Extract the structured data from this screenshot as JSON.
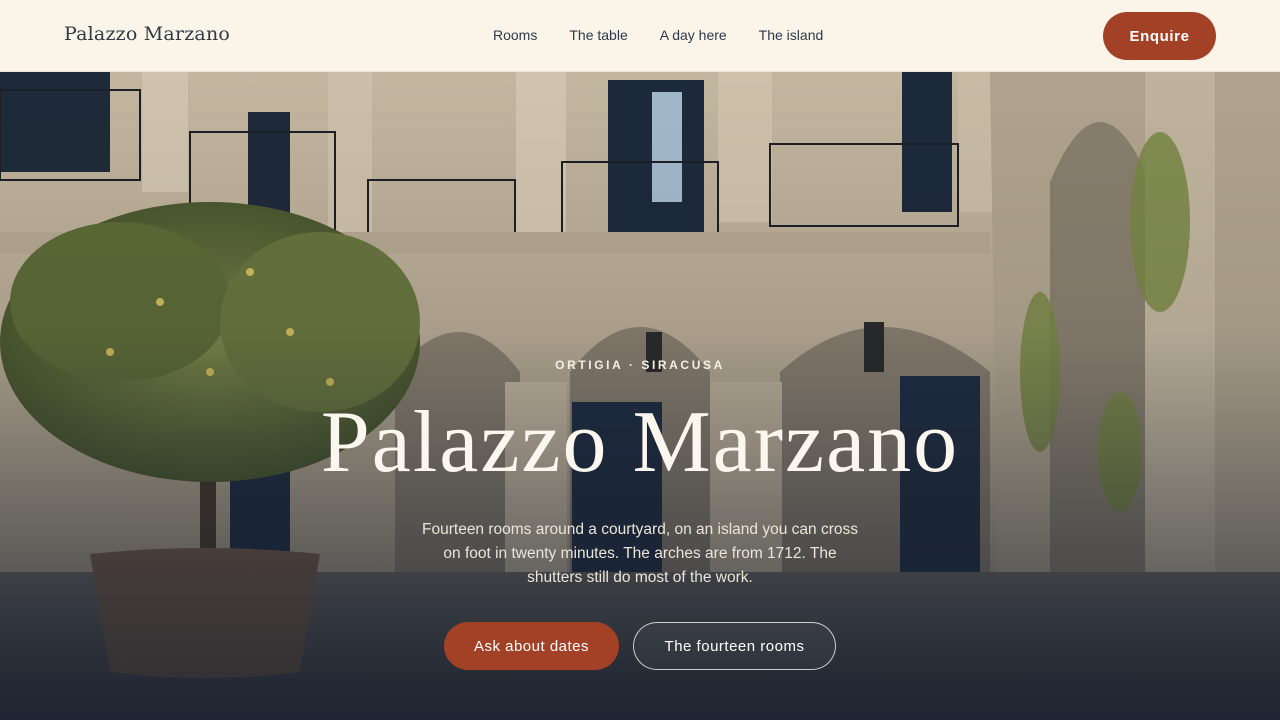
{
  "nav": {
    "brand": "Palazzo Marzano",
    "links": [
      "Rooms",
      "The table",
      "A day here",
      "The island"
    ],
    "enquire_label": "Enquire"
  },
  "hero": {
    "eyebrow": "ORTIGIA · SIRACUSA",
    "title": "Palazzo Marzano",
    "description": "Fourteen rooms around a courtyard, on an island you can cross on foot in twenty minutes. The arches are from 1712. The shutters still do most of the work.",
    "primary_cta": "Ask about dates",
    "secondary_cta": "The fourteen rooms",
    "image_alt": "courtyard-photo"
  },
  "colors": {
    "nav_bg": "#faf4e9",
    "accent": "#a24126",
    "ink": "#2f3a45"
  }
}
